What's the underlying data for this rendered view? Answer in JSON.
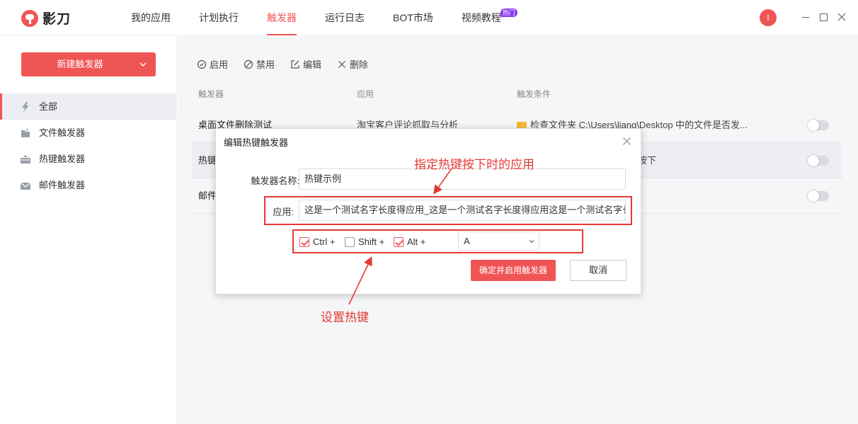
{
  "app": {
    "name": "影刀",
    "avatar_letter": "I"
  },
  "nav": {
    "items": [
      {
        "label": "我的应用"
      },
      {
        "label": "计划执行"
      },
      {
        "label": "触发器"
      },
      {
        "label": "运行日志"
      },
      {
        "label": "BOT市场"
      },
      {
        "label": "视频教程"
      }
    ],
    "active_index": 2,
    "badge": "热门"
  },
  "sidebar": {
    "new_button": "新建触发器",
    "items": [
      {
        "label": "全部",
        "icon": "lightning-icon"
      },
      {
        "label": "文件触发器",
        "icon": "file-icon"
      },
      {
        "label": "热键触发器",
        "icon": "keyboard-icon"
      },
      {
        "label": "邮件触发器",
        "icon": "mail-icon"
      }
    ],
    "active_index": 0
  },
  "toolbar": {
    "enable": "启用",
    "disable": "禁用",
    "edit": "编辑",
    "delete": "删除"
  },
  "table": {
    "headers": [
      "触发器",
      "应用",
      "触发条件"
    ],
    "rows": [
      {
        "name": "桌面文件删除测试",
        "app": "淘宝客户评论抓取与分析",
        "condition": "检查文件夹 C:\\Users\\liang\\Desktop 中的文件是否发...",
        "enabled": false
      },
      {
        "name": "热键",
        "app": "",
        "condition": "按下",
        "enabled": false
      },
      {
        "name": "邮件",
        "app": "",
        "condition": "",
        "enabled": false
      }
    ]
  },
  "dialog": {
    "title": "编辑热键触发器",
    "name_label": "触发器名称:",
    "name_value": "热键示例",
    "app_label": "应用:",
    "app_value": "这是一个测试名字长度得应用_这是一个测试名字长度得应用这是一个测试名字长度",
    "modifiers": [
      {
        "label": "Ctrl +",
        "checked": true
      },
      {
        "label": "Shift +",
        "checked": false
      },
      {
        "label": "Alt +",
        "checked": true
      }
    ],
    "key_value": "A",
    "confirm": "确定并启用触发器",
    "cancel": "取消"
  },
  "annotations": {
    "app_note": "指定热键按下时的应用",
    "hotkey_note": "设置热键",
    "color": "#e53935"
  },
  "colors": {
    "accent": "#f05556",
    "badge": "#8b3cf0"
  }
}
